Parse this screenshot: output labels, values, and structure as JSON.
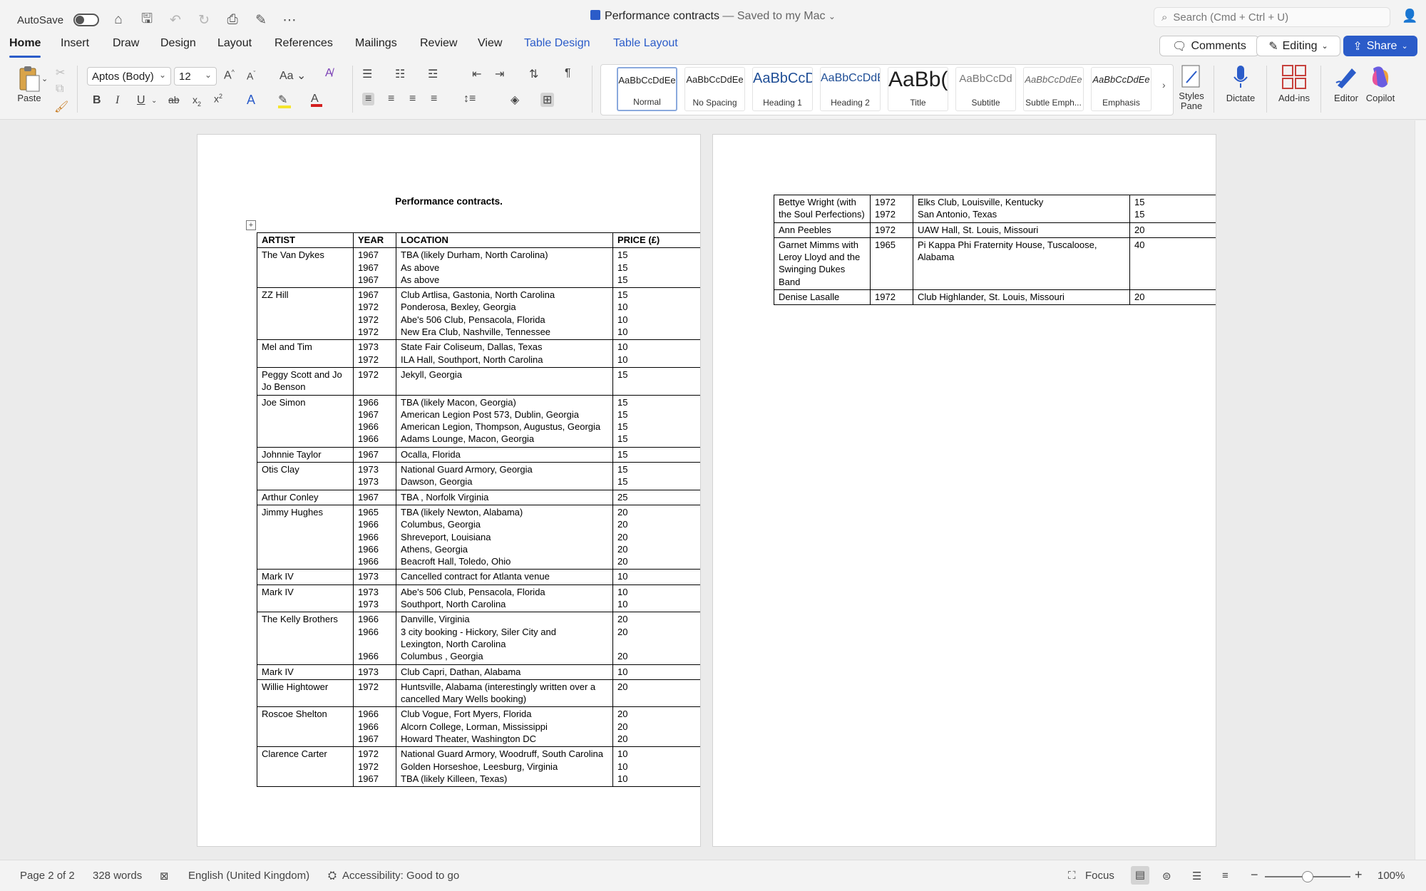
{
  "titlebar": {
    "autosave_label": "AutoSave",
    "doc_name": "Performance contracts",
    "saved_status": "— Saved to my Mac",
    "search_placeholder": "Search (Cmd + Ctrl + U)"
  },
  "tabs": [
    "Home",
    "Insert",
    "Draw",
    "Design",
    "Layout",
    "References",
    "Mailings",
    "Review",
    "View",
    "Table Design",
    "Table Layout"
  ],
  "actions": {
    "comments": "Comments",
    "editing": "Editing",
    "share": "Share"
  },
  "ribbon": {
    "paste_label": "Paste",
    "font_name": "Aptos (Body)",
    "font_size": "12",
    "aa_label": "Aa",
    "styles": [
      {
        "preview": "AaBbCcDdEe",
        "name": "Normal"
      },
      {
        "preview": "AaBbCcDdEe",
        "name": "No Spacing"
      },
      {
        "preview": "AaBbCcDc",
        "name": "Heading 1"
      },
      {
        "preview": "AaBbCcDdE",
        "name": "Heading 2"
      },
      {
        "preview": "AaBb(",
        "name": "Title"
      },
      {
        "preview": "AaBbCcDd",
        "name": "Subtitle"
      },
      {
        "preview": "AaBbCcDdEe",
        "name": "Subtle Emph..."
      },
      {
        "preview": "AaBbCcDdEe",
        "name": "Emphasis"
      }
    ],
    "styles_pane": "Styles Pane",
    "dictate": "Dictate",
    "addins": "Add-ins",
    "editor": "Editor",
    "copilot": "Copilot"
  },
  "document": {
    "heading": "Performance contracts.",
    "headers": [
      "ARTIST",
      "YEAR",
      "LOCATION",
      "PRICE (£)"
    ],
    "page1_rows": [
      {
        "artist": "The Van Dykes",
        "years": [
          "1967",
          "1967",
          "1967"
        ],
        "locations": [
          "TBA (likely Durham, North Carolina)",
          "As above",
          "As above"
        ],
        "prices": [
          "15",
          "15",
          "15"
        ]
      },
      {
        "artist": "ZZ Hill",
        "years": [
          "1967",
          "1972",
          "1972",
          "1972"
        ],
        "locations": [
          "Club Artlisa, Gastonia, North Carolina",
          "Ponderosa, Bexley, Georgia",
          "Abe's 506 Club, Pensacola, Florida",
          "New Era Club, Nashville, Tennessee"
        ],
        "prices": [
          "15",
          "10",
          "10",
          "10"
        ]
      },
      {
        "artist": "Mel and Tim",
        "years": [
          "1973",
          "1972"
        ],
        "locations": [
          "State Fair Coliseum, Dallas, Texas",
          "ILA Hall, Southport, North Carolina"
        ],
        "prices": [
          "10",
          "10"
        ]
      },
      {
        "artist": "Peggy Scott and Jo Jo Benson",
        "years": [
          "1972"
        ],
        "locations": [
          "Jekyll, Georgia"
        ],
        "prices": [
          "15"
        ]
      },
      {
        "artist": "Joe Simon",
        "years": [
          "1966",
          "1967",
          "1966",
          "1966"
        ],
        "locations": [
          "TBA (likely Macon, Georgia)",
          "American Legion Post 573, Dublin, Georgia",
          "American Legion, Thompson, Augustus, Georgia",
          "Adams Lounge, Macon, Georgia"
        ],
        "prices": [
          "15",
          "15",
          "15",
          "15"
        ]
      },
      {
        "artist": "Johnnie Taylor",
        "years": [
          "1967"
        ],
        "locations": [
          "Ocalla, Florida"
        ],
        "prices": [
          "15"
        ]
      },
      {
        "artist": "Otis Clay",
        "years": [
          "1973",
          "1973"
        ],
        "locations": [
          "National Guard Armory, Georgia",
          "Dawson, Georgia"
        ],
        "prices": [
          "15",
          "15"
        ]
      },
      {
        "artist": "Arthur Conley",
        "years": [
          "1967"
        ],
        "locations": [
          "TBA , Norfolk Virginia"
        ],
        "prices": [
          "25"
        ]
      },
      {
        "artist": "Jimmy Hughes",
        "years": [
          "1965",
          "1966",
          "1966",
          "1966",
          "1966"
        ],
        "locations": [
          "TBA (likely Newton, Alabama)",
          "Columbus, Georgia",
          "Shreveport, Louisiana",
          "Athens, Georgia",
          "Beacroft Hall, Toledo, Ohio"
        ],
        "prices": [
          "20",
          "20",
          "20",
          "20",
          "20"
        ]
      },
      {
        "artist": "Mark IV",
        "years": [
          "1973"
        ],
        "locations": [
          "Cancelled contract for Atlanta venue"
        ],
        "prices": [
          "10"
        ]
      },
      {
        "artist": "Mark IV",
        "years": [
          "1973",
          "1973"
        ],
        "locations": [
          "Abe's 506 Club, Pensacola, Florida",
          "Southport, North Carolina"
        ],
        "prices": [
          "10",
          "10"
        ]
      },
      {
        "artist": "The Kelly Brothers",
        "years": [
          "1966",
          "1966",
          "",
          "1966"
        ],
        "locations": [
          "Danville, Virginia",
          "3 city booking - Hickory, Siler City and",
          "Lexington, North Carolina",
          "Columbus , Georgia"
        ],
        "prices": [
          "20",
          "20",
          "",
          "20"
        ]
      },
      {
        "artist": "Mark IV",
        "years": [
          "1973"
        ],
        "locations": [
          "Club Capri, Dathan, Alabama"
        ],
        "prices": [
          "10"
        ]
      },
      {
        "artist": "Willie Hightower",
        "years": [
          "1972"
        ],
        "locations": [
          "Huntsville, Alabama (interestingly written over a cancelled Mary Wells booking)"
        ],
        "prices": [
          "20"
        ]
      },
      {
        "artist": "Roscoe Shelton",
        "years": [
          "1966",
          "1966",
          "1967"
        ],
        "locations": [
          "Club Vogue, Fort Myers, Florida",
          "Alcorn College, Lorman, Mississippi",
          "Howard Theater, Washington DC"
        ],
        "prices": [
          "20",
          "20",
          "20"
        ]
      },
      {
        "artist": "Clarence Carter",
        "years": [
          "1972",
          "1972",
          "1967"
        ],
        "locations": [
          "National Guard Armory, Woodruff, South Carolina",
          "Golden Horseshoe, Leesburg, Virginia",
          "TBA (likely Killeen, Texas)"
        ],
        "prices": [
          "10",
          "10",
          "10"
        ]
      }
    ],
    "page2_rows": [
      {
        "artist": "Bettye Wright (with the Soul Perfections)",
        "years": [
          "1972",
          "1972"
        ],
        "locations": [
          "Elks Club, Louisville, Kentucky",
          "San Antonio, Texas"
        ],
        "prices": [
          "15",
          "15"
        ]
      },
      {
        "artist": "Ann Peebles",
        "years": [
          "1972"
        ],
        "locations": [
          "UAW Hall, St. Louis, Missouri"
        ],
        "prices": [
          "20"
        ]
      },
      {
        "artist": "Garnet Mimms with Leroy Lloyd and the Swinging Dukes Band",
        "years": [
          "1965"
        ],
        "locations": [
          "Pi Kappa Phi Fraternity House, Tuscaloose, Alabama"
        ],
        "prices": [
          "40"
        ]
      },
      {
        "artist": "Denise Lasalle",
        "years": [
          "1972"
        ],
        "locations": [
          "Club Highlander, St. Louis, Missouri"
        ],
        "prices": [
          "20"
        ]
      }
    ]
  },
  "statusbar": {
    "page": "Page 2 of 2",
    "words": "328 words",
    "language": "English (United Kingdom)",
    "accessibility": "Accessibility: Good to go",
    "focus": "Focus",
    "zoom": "100%"
  }
}
